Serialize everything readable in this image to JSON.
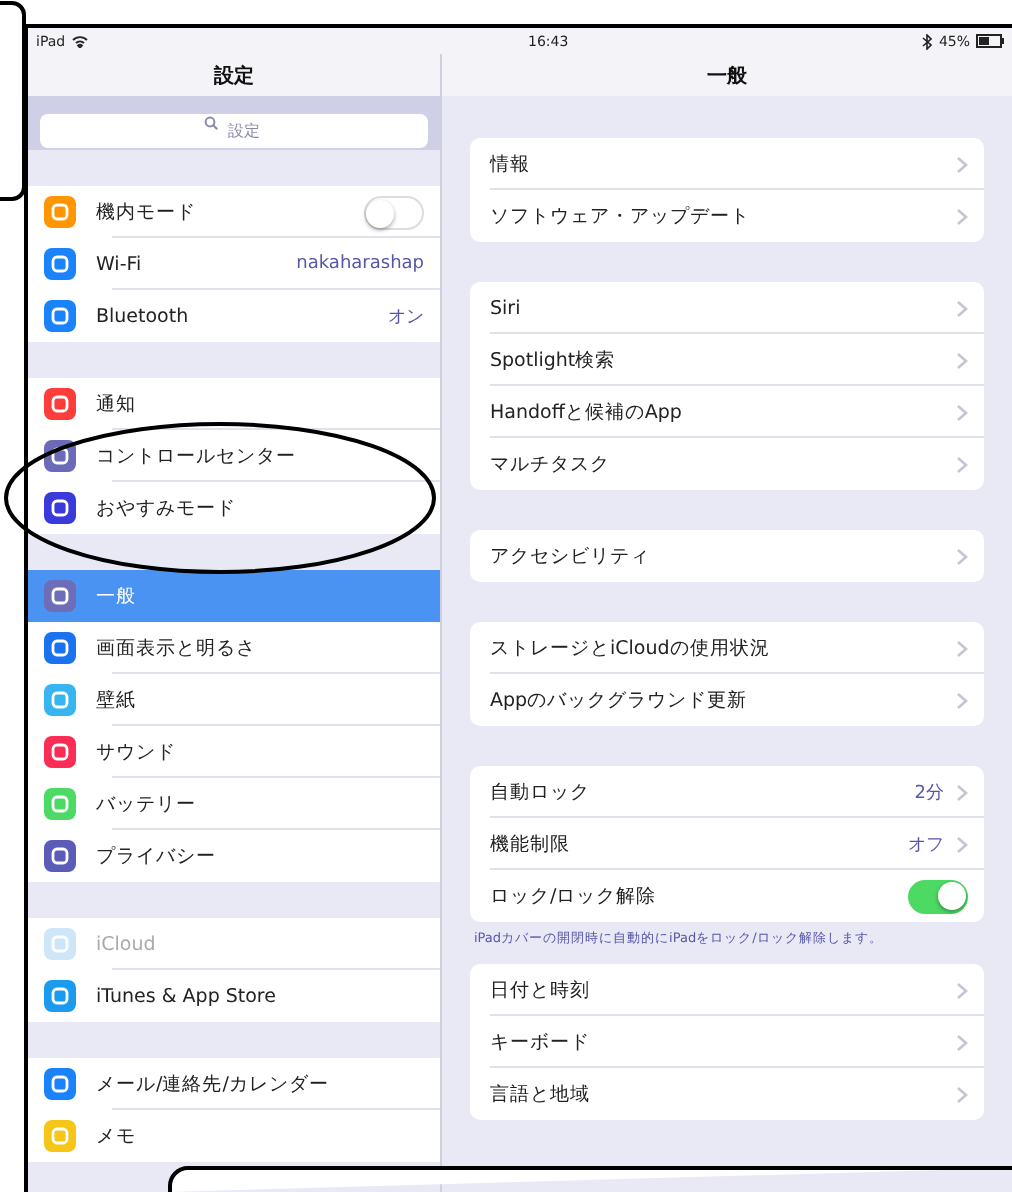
{
  "status_bar": {
    "device": "iPad",
    "time": "16:43",
    "battery": "45%"
  },
  "sidebar": {
    "title": "設定",
    "search": {
      "placeholder": "設定"
    },
    "groups": [
      {
        "items": [
          {
            "label": "機内モード",
            "kind": "toggle",
            "on": false,
            "color": "#ff9500",
            "selected": false
          },
          {
            "label": "Wi-Fi",
            "kind": "link",
            "value": "nakaharashap",
            "color": "#1a82fb",
            "selected": false
          },
          {
            "label": "Bluetooth",
            "kind": "link",
            "value": "オン",
            "color": "#1a82fb",
            "selected": false
          }
        ]
      },
      {
        "items": [
          {
            "label": "通知",
            "kind": "link",
            "color": "#fc3d39",
            "selected": false
          },
          {
            "label": "コントロールセンター",
            "kind": "link",
            "color": "#6a6ab8",
            "selected": false
          },
          {
            "label": "おやすみモード",
            "kind": "link",
            "color": "#3a3adc",
            "selected": false
          }
        ]
      },
      {
        "items": [
          {
            "label": "一般",
            "kind": "link",
            "color": "#6e6eb8",
            "selected": true
          },
          {
            "label": "画面表示と明るさ",
            "kind": "link",
            "color": "#1a72f0",
            "selected": false
          },
          {
            "label": "壁紙",
            "kind": "link",
            "color": "#36b5f0",
            "selected": false
          },
          {
            "label": "サウンド",
            "kind": "link",
            "color": "#fc2d55",
            "selected": false
          },
          {
            "label": "バッテリー",
            "kind": "link",
            "color": "#4cd964",
            "selected": false
          },
          {
            "label": "プライバシー",
            "kind": "link",
            "color": "#5b5bb8",
            "selected": false
          }
        ]
      },
      {
        "items": [
          {
            "label": "iCloud",
            "kind": "link",
            "color": "#cfe6f8",
            "selected": false,
            "disabled": true
          },
          {
            "label": "iTunes & App Store",
            "kind": "link",
            "color": "#1a9bf0",
            "selected": false
          }
        ]
      },
      {
        "items": [
          {
            "label": "メール/連絡先/カレンダー",
            "kind": "link",
            "color": "#1a82fb",
            "selected": false
          },
          {
            "label": "メモ",
            "kind": "link",
            "color": "#f5c518",
            "selected": false
          }
        ]
      }
    ]
  },
  "detail": {
    "title": "一般",
    "groups": [
      {
        "items": [
          {
            "label": "情報",
            "kind": "link"
          },
          {
            "label": "ソフトウェア・アップデート",
            "kind": "link"
          }
        ]
      },
      {
        "items": [
          {
            "label": "Siri",
            "kind": "link"
          },
          {
            "label": "Spotlight検索",
            "kind": "link"
          },
          {
            "label": "Handoffと候補のApp",
            "kind": "link"
          },
          {
            "label": "マルチタスク",
            "kind": "link"
          }
        ]
      },
      {
        "items": [
          {
            "label": "アクセシビリティ",
            "kind": "link"
          }
        ]
      },
      {
        "items": [
          {
            "label": "ストレージとiCloudの使用状況",
            "kind": "link"
          },
          {
            "label": "Appのバックグラウンド更新",
            "kind": "link"
          }
        ]
      },
      {
        "items": [
          {
            "label": "自動ロック",
            "kind": "link",
            "value": "2分"
          },
          {
            "label": "機能制限",
            "kind": "link",
            "value": "オフ"
          },
          {
            "label": "ロック/ロック解除",
            "kind": "toggle",
            "on": true
          }
        ],
        "footer": "iPadカバーの開閉時に自動的にiPadをロック/ロック解除します。"
      },
      {
        "items": [
          {
            "label": "日付と時刻",
            "kind": "link"
          },
          {
            "label": "キーボード",
            "kind": "link"
          },
          {
            "label": "言語と地域",
            "kind": "link"
          }
        ]
      }
    ]
  }
}
